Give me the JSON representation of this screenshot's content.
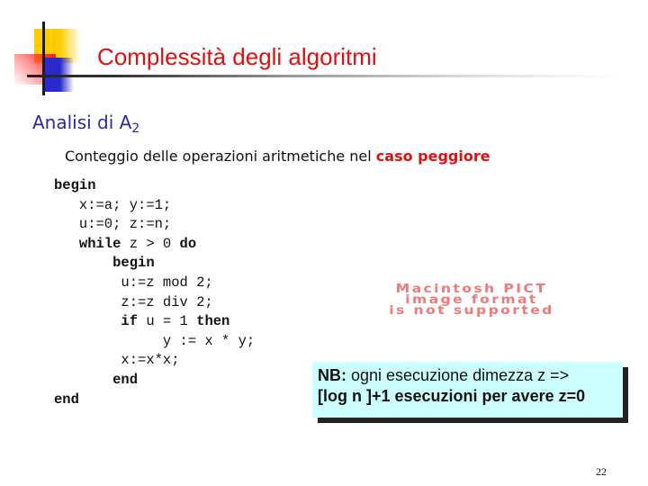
{
  "slide": {
    "title": "Complessità degli algoritmi",
    "subheading": {
      "text": "Analisi di A",
      "subscript": "2"
    },
    "description": {
      "text": "Conteggio delle operazioni aritmetiche nel ",
      "highlight": "caso peggiore"
    },
    "code": [
      {
        "indent": "",
        "parts": [
          {
            "t": "begin",
            "kw": true
          }
        ]
      },
      {
        "indent": "   ",
        "parts": [
          {
            "t": "x:=a; y:=1;",
            "kw": false
          }
        ]
      },
      {
        "indent": "   ",
        "parts": [
          {
            "t": "u:=0; z:=n;",
            "kw": false
          }
        ]
      },
      {
        "indent": "   ",
        "parts": [
          {
            "t": "while",
            "kw": true
          },
          {
            "t": " z > 0 ",
            "kw": false
          },
          {
            "t": "do",
            "kw": true
          }
        ]
      },
      {
        "indent": "       ",
        "parts": [
          {
            "t": "begin",
            "kw": true
          }
        ]
      },
      {
        "indent": "        ",
        "parts": [
          {
            "t": "u:=z mod 2;",
            "kw": false
          }
        ]
      },
      {
        "indent": "        ",
        "parts": [
          {
            "t": "z:=z div 2;",
            "kw": false
          }
        ]
      },
      {
        "indent": "        ",
        "parts": [
          {
            "t": "if",
            "kw": true
          },
          {
            "t": " u = 1 ",
            "kw": false
          },
          {
            "t": "then",
            "kw": true
          }
        ]
      },
      {
        "indent": "             ",
        "parts": [
          {
            "t": "y := x * y;",
            "kw": false
          }
        ]
      },
      {
        "indent": "        ",
        "parts": [
          {
            "t": "x:=x*x;",
            "kw": false
          }
        ]
      },
      {
        "indent": "       ",
        "parts": [
          {
            "t": "end",
            "kw": true
          }
        ]
      },
      {
        "indent": "",
        "parts": [
          {
            "t": "end",
            "kw": true
          }
        ]
      }
    ],
    "pict_placeholder": [
      "Macintosh PICT",
      "image format",
      "is not supported"
    ],
    "note": {
      "label": "NB:",
      "line1": " ogni esecuzione dimezza z =>",
      "line2": "[log n ]+1 esecuzioni per avere z=0"
    },
    "page_number": "22",
    "colors": {
      "title": "#e01010",
      "subheading": "#2a2aa0",
      "highlight": "#e01010",
      "note_background": "#ccffff"
    }
  }
}
